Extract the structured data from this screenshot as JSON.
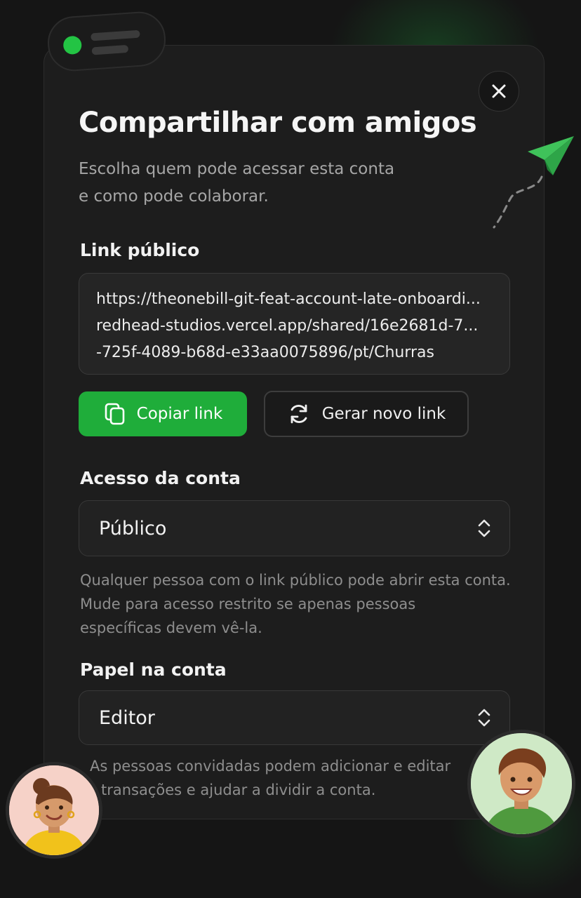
{
  "dialog": {
    "title": "Compartilhar com amigos",
    "subtitle_line1": "Escolha quem pode acessar esta conta",
    "subtitle_line2": "e como pode colaborar."
  },
  "public_link": {
    "label": "Link público",
    "url_line1": "https://theonebill-git-feat-account-late-onboardi...",
    "url_line2": "redhead-studios.vercel.app/shared/16e2681d-7...",
    "url_line3": "-725f-4089-b68d-e33aa0075896/pt/Churras",
    "copy_button": "Copiar link",
    "regenerate_button": "Gerar novo link"
  },
  "access": {
    "label": "Acesso da conta",
    "selected": "Público",
    "help_line1": "Qualquer pessoa com o link público pode abrir esta conta.",
    "help_line2": "Mude para acesso restrito se apenas pessoas",
    "help_line3": "específicas devem vê-la."
  },
  "role": {
    "label": "Papel na conta",
    "selected": "Editor",
    "help_line1": "As pessoas convidadas podem adicionar e editar",
    "help_line2": "transações e ajudar a dividir a conta."
  },
  "icons": {
    "close": "close-icon",
    "copy": "copy-icon",
    "refresh": "refresh-icon",
    "select": "chevron-up-down-icon",
    "plane": "paper-plane-icon"
  },
  "colors": {
    "accent": "#1fad3a",
    "status_dot": "#23c444",
    "background": "#151515",
    "panel": "#1d1d1d"
  }
}
